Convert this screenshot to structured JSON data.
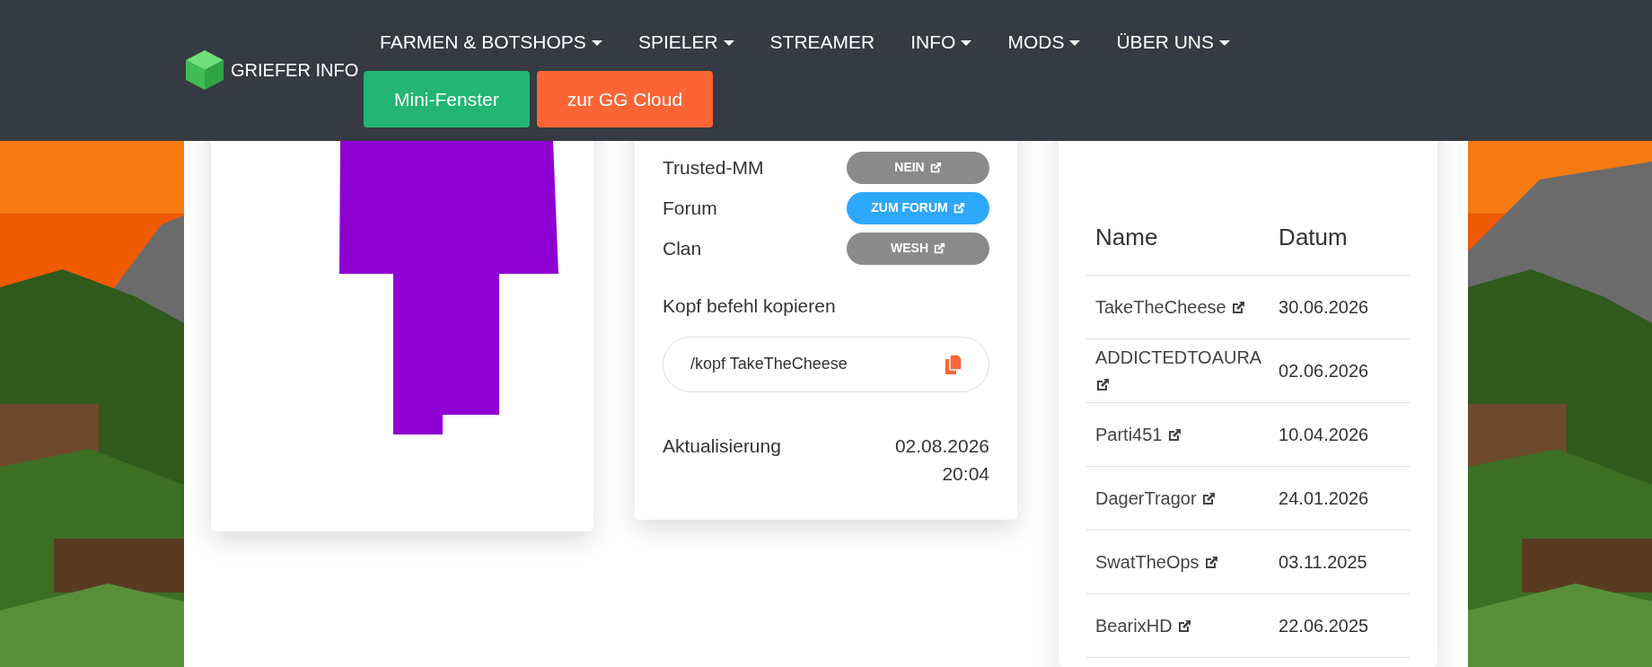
{
  "navbar": {
    "brand": "GRIEFER INFO",
    "links": [
      {
        "label": "FARMEN & BOTSHOPS",
        "dropdown": true
      },
      {
        "label": "SPIELER",
        "dropdown": true
      },
      {
        "label": "STREAMER",
        "dropdown": false
      },
      {
        "label": "INFO",
        "dropdown": true
      },
      {
        "label": "MODS",
        "dropdown": true
      },
      {
        "label": "ÜBER UNS",
        "dropdown": true
      }
    ],
    "buttons": [
      {
        "label": "Mini-Fenster",
        "color": "#22b573"
      },
      {
        "label": "zur GG Cloud",
        "color": "#fb6535"
      }
    ]
  },
  "profile": {
    "rows": [
      {
        "label": "Trusted-MM",
        "badge": "NEIN",
        "color": "#8a8a8a"
      },
      {
        "label": "Forum",
        "badge": "ZUM FORUM",
        "color": "#2ea8fb"
      },
      {
        "label": "Clan",
        "badge": "WESH",
        "color": "#8a8a8a"
      }
    ],
    "head_command": {
      "label": "Kopf befehl kopieren",
      "value": "/kopf TakeTheCheese"
    },
    "updated": {
      "label": "Aktualisierung",
      "date": "02.08.2026",
      "time": "20:04"
    }
  },
  "names_table": {
    "columns": [
      "Name",
      "Datum"
    ],
    "rows": [
      {
        "name": "TakeTheCheese",
        "date": "30.06.2026"
      },
      {
        "name": "ADDICTEDTOAURA",
        "date": "02.06.2026"
      },
      {
        "name": "Parti451",
        "date": "10.04.2026"
      },
      {
        "name": "DagerTragor",
        "date": "24.01.2026"
      },
      {
        "name": "SwatTheOps",
        "date": "03.11.2025"
      },
      {
        "name": "BearixHD",
        "date": "22.06.2025"
      }
    ]
  }
}
